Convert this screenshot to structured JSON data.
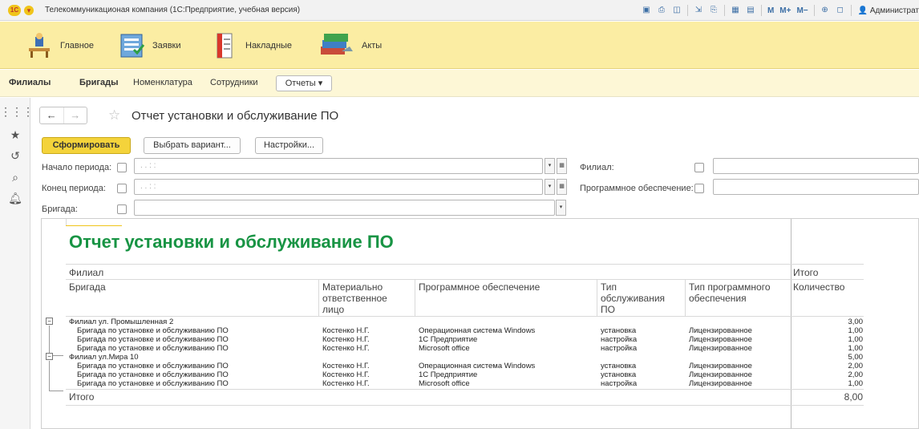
{
  "titlebar": {
    "app_title": "Телекоммуникационая компания  (1С:Предприятие, учебная версия)",
    "user": "Администрат"
  },
  "sections": [
    {
      "label": "Главное",
      "icon": "desk-icon"
    },
    {
      "label": "Заявки",
      "icon": "requests-icon"
    },
    {
      "label": "Накладные",
      "icon": "invoices-icon"
    },
    {
      "label": "Акты",
      "icon": "acts-icon"
    }
  ],
  "nav": {
    "items": [
      "Филиалы",
      "Бригады",
      "Номенклатура",
      "Сотрудники"
    ],
    "reports": "Отчеты ▾"
  },
  "form": {
    "title": "Отчет установки и обслуживание ПО",
    "btn_generate": "Сформировать",
    "btn_variant": "Выбрать вариант...",
    "btn_settings": "Настройки...",
    "filters": {
      "period_start": "Начало периода:",
      "period_end": "Конец периода:",
      "brigade": "Бригада:",
      "branch": "Филиал:",
      "software": "Программное обеспечение:",
      "date_placeholder": ". .    : :"
    }
  },
  "report": {
    "title": "Отчет установки и обслуживание ПО",
    "headers": {
      "branch": "Филиал",
      "total": "Итого",
      "brigade": "Бригада",
      "person": "Материально ответственное лицо",
      "software": "Программное обеспечение",
      "service": "Тип обслуживания ПО",
      "sw_type": "Тип программного обеспечения",
      "qty": "Количество"
    },
    "groups": [
      {
        "name": "Филиал ул. Промышленная 2",
        "qty": "3,00",
        "rows": [
          [
            "Бригада по установке и обслуживанию ПО",
            "Костенко Н.Г.",
            "Операционная система Windows",
            "установка",
            "Лицензированное",
            "1,00"
          ],
          [
            "Бригада по установке и обслуживанию ПО",
            "Костенко Н.Г.",
            "1С Предприятие",
            "настройка",
            "Лицензированное",
            "1,00"
          ],
          [
            "Бригада по установке и обслуживанию ПО",
            "Костенко Н.Г.",
            "Microsoft office",
            "настройка",
            "Лицензированное",
            "1,00"
          ]
        ]
      },
      {
        "name": "Филиал ул.Мира 10",
        "qty": "5,00",
        "rows": [
          [
            "Бригада по установке и обслуживанию ПО",
            "Костенко Н.Г.",
            "Операционная система Windows",
            "установка",
            "Лицензированное",
            "2,00"
          ],
          [
            "Бригада по установке и обслуживанию ПО",
            "Костенко Н.Г.",
            "1С Предприятие",
            "установка",
            "Лицензированное",
            "2,00"
          ],
          [
            "Бригада по установке и обслуживанию ПО",
            "Костенко Н.Г.",
            "Microsoft office",
            "настройка",
            "Лицензированное",
            "1,00"
          ]
        ]
      }
    ],
    "total_label": "Итого",
    "total_value": "8,00"
  },
  "colors": {
    "accent": "#f4d33b",
    "report_title": "#189444",
    "sections_bg": "#fbeda3"
  }
}
